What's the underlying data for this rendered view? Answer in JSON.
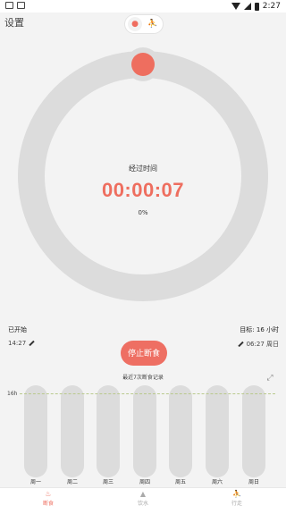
{
  "status_bar": {
    "time": "2:27"
  },
  "header": {
    "title": "设置"
  },
  "mode_toggle": {
    "fast_icon": "flame-icon",
    "walk_icon": "walk-icon",
    "walk_glyph": "⛹"
  },
  "timer": {
    "label": "经过时间",
    "elapsed": "00:00:07",
    "progress": "0%",
    "progress_value": 0,
    "ring_color": "#dcdcdc",
    "accent": "#ee6e5f"
  },
  "started": {
    "label": "已开始",
    "time": "14:27"
  },
  "goal": {
    "label": "目标: 16 小时",
    "time": "06:27 周日"
  },
  "stop_button": {
    "label": "停止断食"
  },
  "history": {
    "title": "最近7次断食记录",
    "goal_marker": "16h",
    "days": [
      "周一",
      "周二",
      "周三",
      "周四",
      "周五",
      "周六",
      "周日"
    ]
  },
  "nav": {
    "items": [
      {
        "label": "断食",
        "icon": "fork-knife-icon"
      },
      {
        "label": "饮水",
        "icon": "water-drop-icon"
      },
      {
        "label": "行走",
        "icon": "walk-icon"
      }
    ]
  }
}
